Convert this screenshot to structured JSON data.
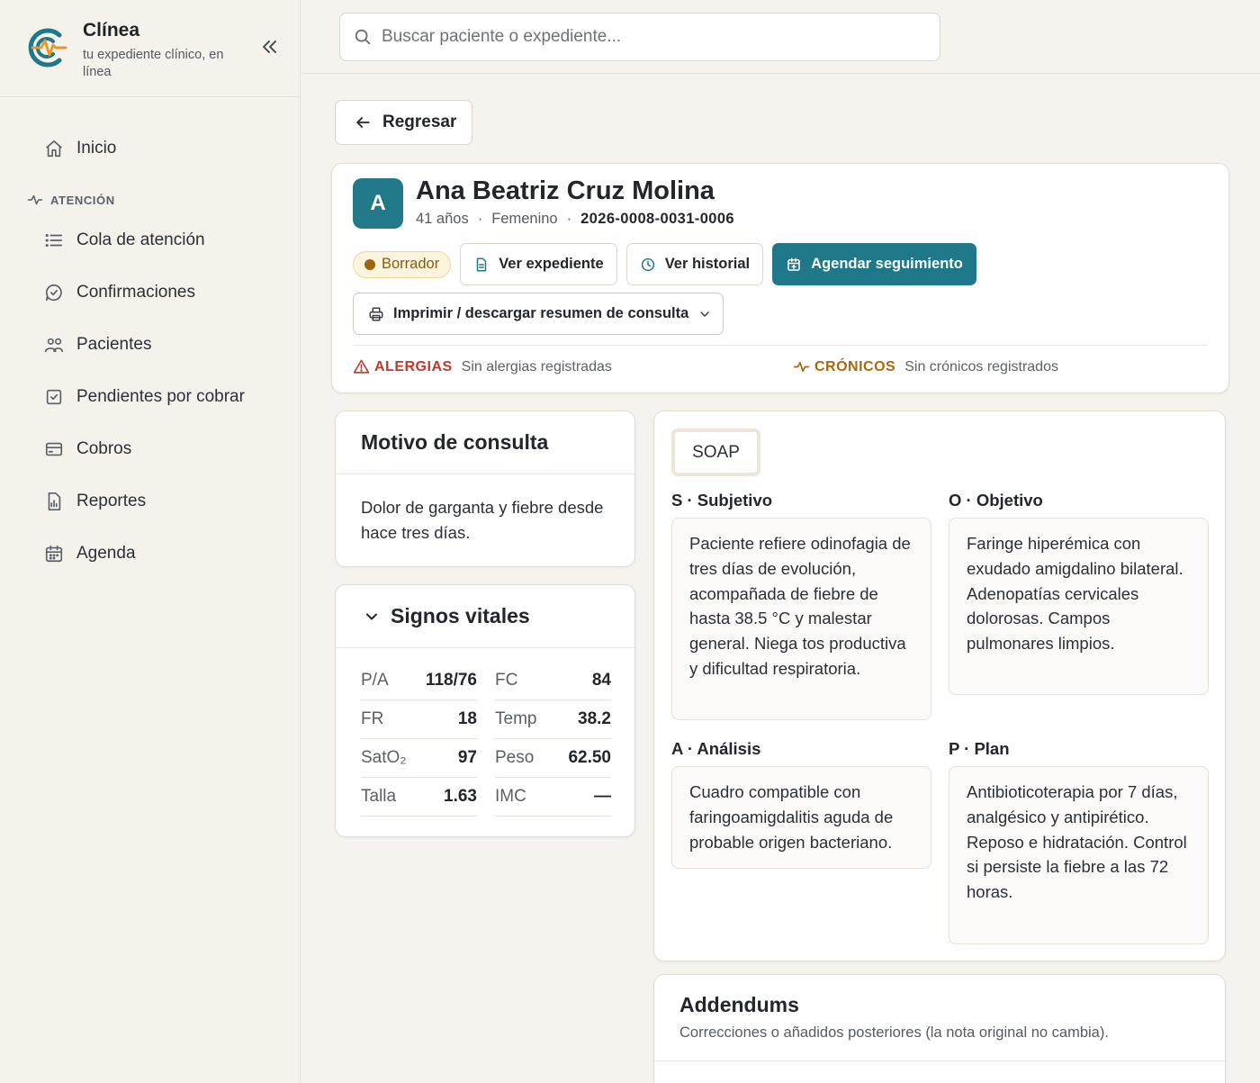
{
  "brand": {
    "name": "Clínea",
    "tagline": "tu expediente clínico, en línea",
    "colors": {
      "primary": "#1f7889",
      "accent": "#e49a2d"
    }
  },
  "sidebar": {
    "items_top": [
      {
        "label": "Inicio",
        "icon": "home-icon"
      }
    ],
    "section": {
      "label": "ATENCIÓN",
      "icon": "pulse-icon"
    },
    "items": [
      {
        "label": "Cola de atención",
        "icon": "list-icon"
      },
      {
        "label": "Confirmaciones",
        "icon": "chat-check-icon"
      },
      {
        "label": "Pacientes",
        "icon": "users-icon"
      },
      {
        "label": "Pendientes por cobrar",
        "icon": "checkbox-icon"
      },
      {
        "label": "Cobros",
        "icon": "credit-card-icon"
      },
      {
        "label": "Reportes",
        "icon": "report-icon"
      },
      {
        "label": "Agenda",
        "icon": "calendar-icon"
      }
    ]
  },
  "search": {
    "placeholder": "Buscar paciente o expediente..."
  },
  "back": {
    "label": "Regresar"
  },
  "patient": {
    "initial": "A",
    "name": "Ana Beatriz Cruz Molina",
    "age": "41 años",
    "sex": "Femenino",
    "record_id": "2026-0008-0031-0006",
    "status": "Borrador",
    "actions": {
      "view_record": "Ver expediente",
      "view_history": "Ver historial",
      "schedule": "Agendar seguimiento",
      "print": "Imprimir / descargar resumen de consulta"
    },
    "allergies": {
      "label": "ALERGIAS",
      "value": "Sin alergias registradas",
      "color": "#c0392b"
    },
    "chronic": {
      "label": "CRÓNICOS",
      "value": "Sin crónicos registrados",
      "color": "#a8690f"
    }
  },
  "motivo": {
    "title": "Motivo de consulta",
    "text": "Dolor de garganta y fiebre desde hace tres días."
  },
  "vitals": {
    "title": "Signos vitales",
    "rows": [
      {
        "k1": "P/A",
        "v1": "118/76",
        "k2": "FC",
        "v2": "84"
      },
      {
        "k1": "FR",
        "v1": "18",
        "k2": "Temp",
        "v2": "38.2"
      },
      {
        "k1": "SatO₂",
        "v1": "97",
        "k2": "Peso",
        "v2": "62.50"
      },
      {
        "k1": "Talla",
        "v1": "1.63",
        "k2": "IMC",
        "v2": "—"
      }
    ]
  },
  "soap": {
    "tab": "SOAP",
    "s": {
      "label": "S · Subjetivo",
      "text": "Paciente refiere odinofagia de tres días de evolución, acompañada de fiebre de hasta 38.5 °C y malestar general. Niega tos productiva y dificultad respiratoria."
    },
    "o": {
      "label": "O · Objetivo",
      "text": "Faringe hiperémica con exudado amigdalino bilateral. Adenopatías cervicales dolorosas. Campos pulmonares limpios."
    },
    "a": {
      "label": "A · Análisis",
      "text": "Cuadro compatible con faringoamigdalitis aguda de probable origen bacteriano."
    },
    "p": {
      "label": "P · Plan",
      "text": "Antibioticoterapia por 7 días, analgésico y antipirético. Reposo e hidratación. Control si persiste la fiebre a las 72 horas."
    }
  },
  "addendums": {
    "title": "Addendums",
    "subtitle": "Correcciones o añadidos posteriores (la nota original no cambia)."
  }
}
